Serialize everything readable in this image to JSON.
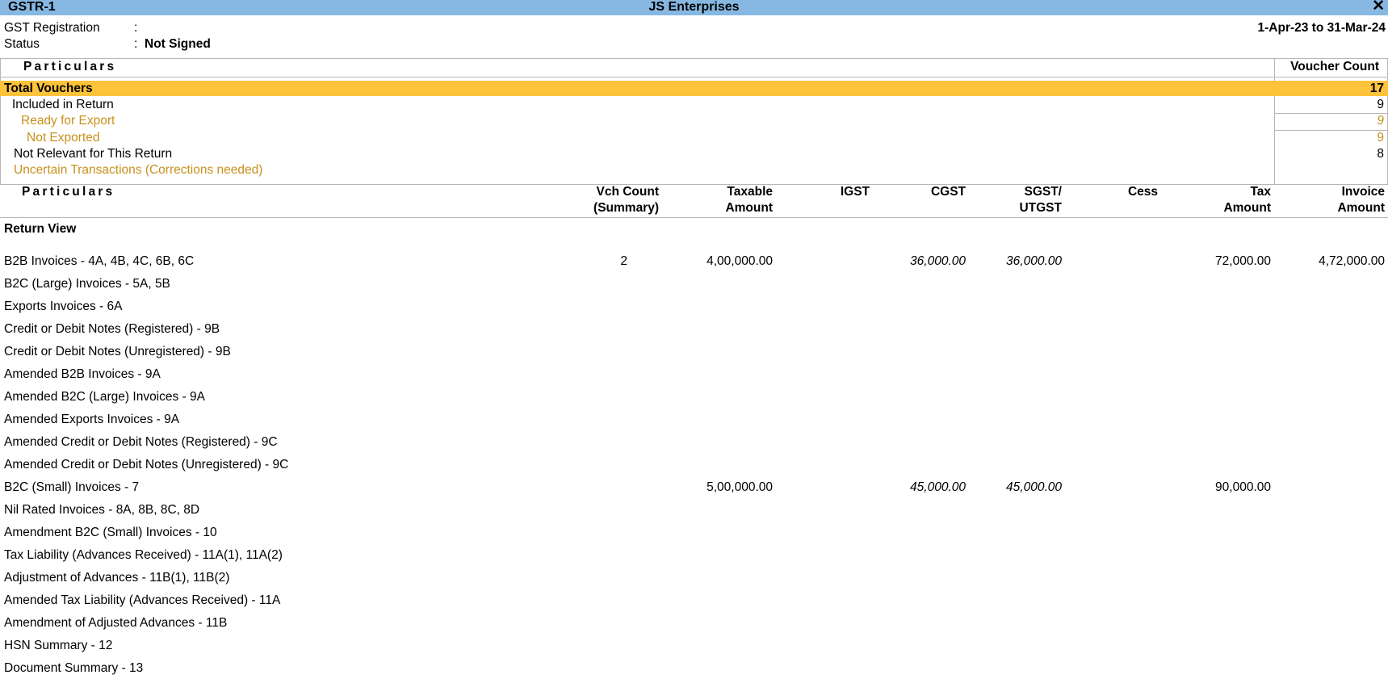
{
  "window": {
    "report_name": "GSTR-1",
    "company": "JS Enterprises",
    "close_glyph": "✕"
  },
  "header": {
    "gst_registration_label": "GST Registration",
    "status_label": "Status",
    "separator": ":",
    "status_value": "Not Signed",
    "period": "1-Apr-23 to 31-Mar-24"
  },
  "summary": {
    "particulars_header": "Particulars",
    "voucher_count_header": "Voucher Count",
    "rows": [
      {
        "label": "Total Vouchers",
        "count": "17"
      },
      {
        "label": "Included in Return",
        "count": "9"
      },
      {
        "label": "Ready for Export",
        "count": "9"
      },
      {
        "label": "Not Exported",
        "count": "9"
      },
      {
        "label": "Not Relevant for This Return",
        "count": "8"
      },
      {
        "label": "Uncertain Transactions (Corrections needed)",
        "count": ""
      }
    ]
  },
  "returns": {
    "columns": {
      "particulars": "Particulars",
      "vch_count_1": "Vch Count",
      "vch_count_2": "(Summary)",
      "taxable_1": "Taxable",
      "taxable_2": "Amount",
      "igst": "IGST",
      "cgst": "CGST",
      "sgst_1": "SGST/",
      "sgst_2": "UTGST",
      "cess": "Cess",
      "tax_1": "Tax",
      "tax_2": "Amount",
      "invoice_1": "Invoice",
      "invoice_2": "Amount"
    },
    "section_title": "Return View",
    "rows": [
      {
        "label": "B2B Invoices - 4A, 4B, 4C, 6B, 6C",
        "vch": "2",
        "taxable": "4,00,000.00",
        "igst": "",
        "cgst": "36,000.00",
        "sgst": "36,000.00",
        "cess": "",
        "tax": "72,000.00",
        "invoice": "4,72,000.00"
      },
      {
        "label": "B2C (Large) Invoices - 5A, 5B",
        "vch": "",
        "taxable": "",
        "igst": "",
        "cgst": "",
        "sgst": "",
        "cess": "",
        "tax": "",
        "invoice": ""
      },
      {
        "label": "Exports Invoices - 6A",
        "vch": "",
        "taxable": "",
        "igst": "",
        "cgst": "",
        "sgst": "",
        "cess": "",
        "tax": "",
        "invoice": ""
      },
      {
        "label": "Credit or Debit Notes (Registered) - 9B",
        "vch": "",
        "taxable": "",
        "igst": "",
        "cgst": "",
        "sgst": "",
        "cess": "",
        "tax": "",
        "invoice": ""
      },
      {
        "label": "Credit or Debit Notes (Unregistered) - 9B",
        "vch": "",
        "taxable": "",
        "igst": "",
        "cgst": "",
        "sgst": "",
        "cess": "",
        "tax": "",
        "invoice": ""
      },
      {
        "label": "Amended B2B Invoices - 9A",
        "vch": "",
        "taxable": "",
        "igst": "",
        "cgst": "",
        "sgst": "",
        "cess": "",
        "tax": "",
        "invoice": ""
      },
      {
        "label": "Amended B2C (Large) Invoices - 9A",
        "vch": "",
        "taxable": "",
        "igst": "",
        "cgst": "",
        "sgst": "",
        "cess": "",
        "tax": "",
        "invoice": ""
      },
      {
        "label": "Amended Exports Invoices - 9A",
        "vch": "",
        "taxable": "",
        "igst": "",
        "cgst": "",
        "sgst": "",
        "cess": "",
        "tax": "",
        "invoice": ""
      },
      {
        "label": "Amended Credit or Debit Notes (Registered) - 9C",
        "vch": "",
        "taxable": "",
        "igst": "",
        "cgst": "",
        "sgst": "",
        "cess": "",
        "tax": "",
        "invoice": ""
      },
      {
        "label": "Amended Credit or Debit Notes (Unregistered) - 9C",
        "vch": "",
        "taxable": "",
        "igst": "",
        "cgst": "",
        "sgst": "",
        "cess": "",
        "tax": "",
        "invoice": ""
      },
      {
        "label": "B2C (Small) Invoices - 7",
        "vch": "",
        "taxable": "5,00,000.00",
        "igst": "",
        "cgst": "45,000.00",
        "sgst": "45,000.00",
        "cess": "",
        "tax": "90,000.00",
        "invoice": ""
      },
      {
        "label": "Nil Rated Invoices - 8A, 8B, 8C, 8D",
        "vch": "",
        "taxable": "",
        "igst": "",
        "cgst": "",
        "sgst": "",
        "cess": "",
        "tax": "",
        "invoice": ""
      },
      {
        "label": "Amendment B2C (Small) Invoices - 10",
        "vch": "",
        "taxable": "",
        "igst": "",
        "cgst": "",
        "sgst": "",
        "cess": "",
        "tax": "",
        "invoice": ""
      },
      {
        "label": "Tax Liability (Advances Received) - 11A(1), 11A(2)",
        "vch": "",
        "taxable": "",
        "igst": "",
        "cgst": "",
        "sgst": "",
        "cess": "",
        "tax": "",
        "invoice": ""
      },
      {
        "label": "Adjustment of Advances - 11B(1), 11B(2)",
        "vch": "",
        "taxable": "",
        "igst": "",
        "cgst": "",
        "sgst": "",
        "cess": "",
        "tax": "",
        "invoice": ""
      },
      {
        "label": "Amended Tax Liability (Advances Received) - 11A",
        "vch": "",
        "taxable": "",
        "igst": "",
        "cgst": "",
        "sgst": "",
        "cess": "",
        "tax": "",
        "invoice": ""
      },
      {
        "label": "Amendment of Adjusted Advances - 11B",
        "vch": "",
        "taxable": "",
        "igst": "",
        "cgst": "",
        "sgst": "",
        "cess": "",
        "tax": "",
        "invoice": ""
      },
      {
        "label": "HSN Summary - 12",
        "vch": "",
        "taxable": "",
        "igst": "",
        "cgst": "",
        "sgst": "",
        "cess": "",
        "tax": "",
        "invoice": ""
      },
      {
        "label": "Document Summary - 13",
        "vch": "",
        "taxable": "",
        "igst": "",
        "cgst": "",
        "sgst": "",
        "cess": "",
        "tax": "",
        "invoice": ""
      }
    ]
  }
}
